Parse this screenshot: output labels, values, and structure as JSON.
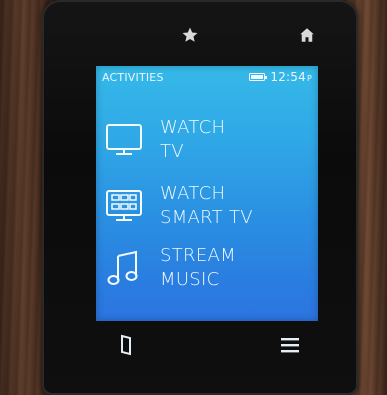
{
  "hardware": {
    "star_icon": "star-icon",
    "home_icon": "home-icon"
  },
  "status_bar": {
    "title": "ACTIVITIES",
    "time": "12:54",
    "time_suffix": "P",
    "battery_icon": "battery-icon"
  },
  "activities": [
    {
      "line1": "WATCH",
      "line2": "TV",
      "icon": "tv-icon"
    },
    {
      "line1": "WATCH",
      "line2": "SMART TV",
      "icon": "smart-tv-icon"
    },
    {
      "line1": "STREAM",
      "line2": "MUSIC",
      "icon": "music-note-icon"
    }
  ],
  "bottom_bar": {
    "left_icon": "device-icon",
    "right_icon": "menu-icon"
  },
  "colors": {
    "screen_top": "#35b9e8",
    "screen_bottom": "#2c74e0",
    "text": "#f3fbff"
  }
}
